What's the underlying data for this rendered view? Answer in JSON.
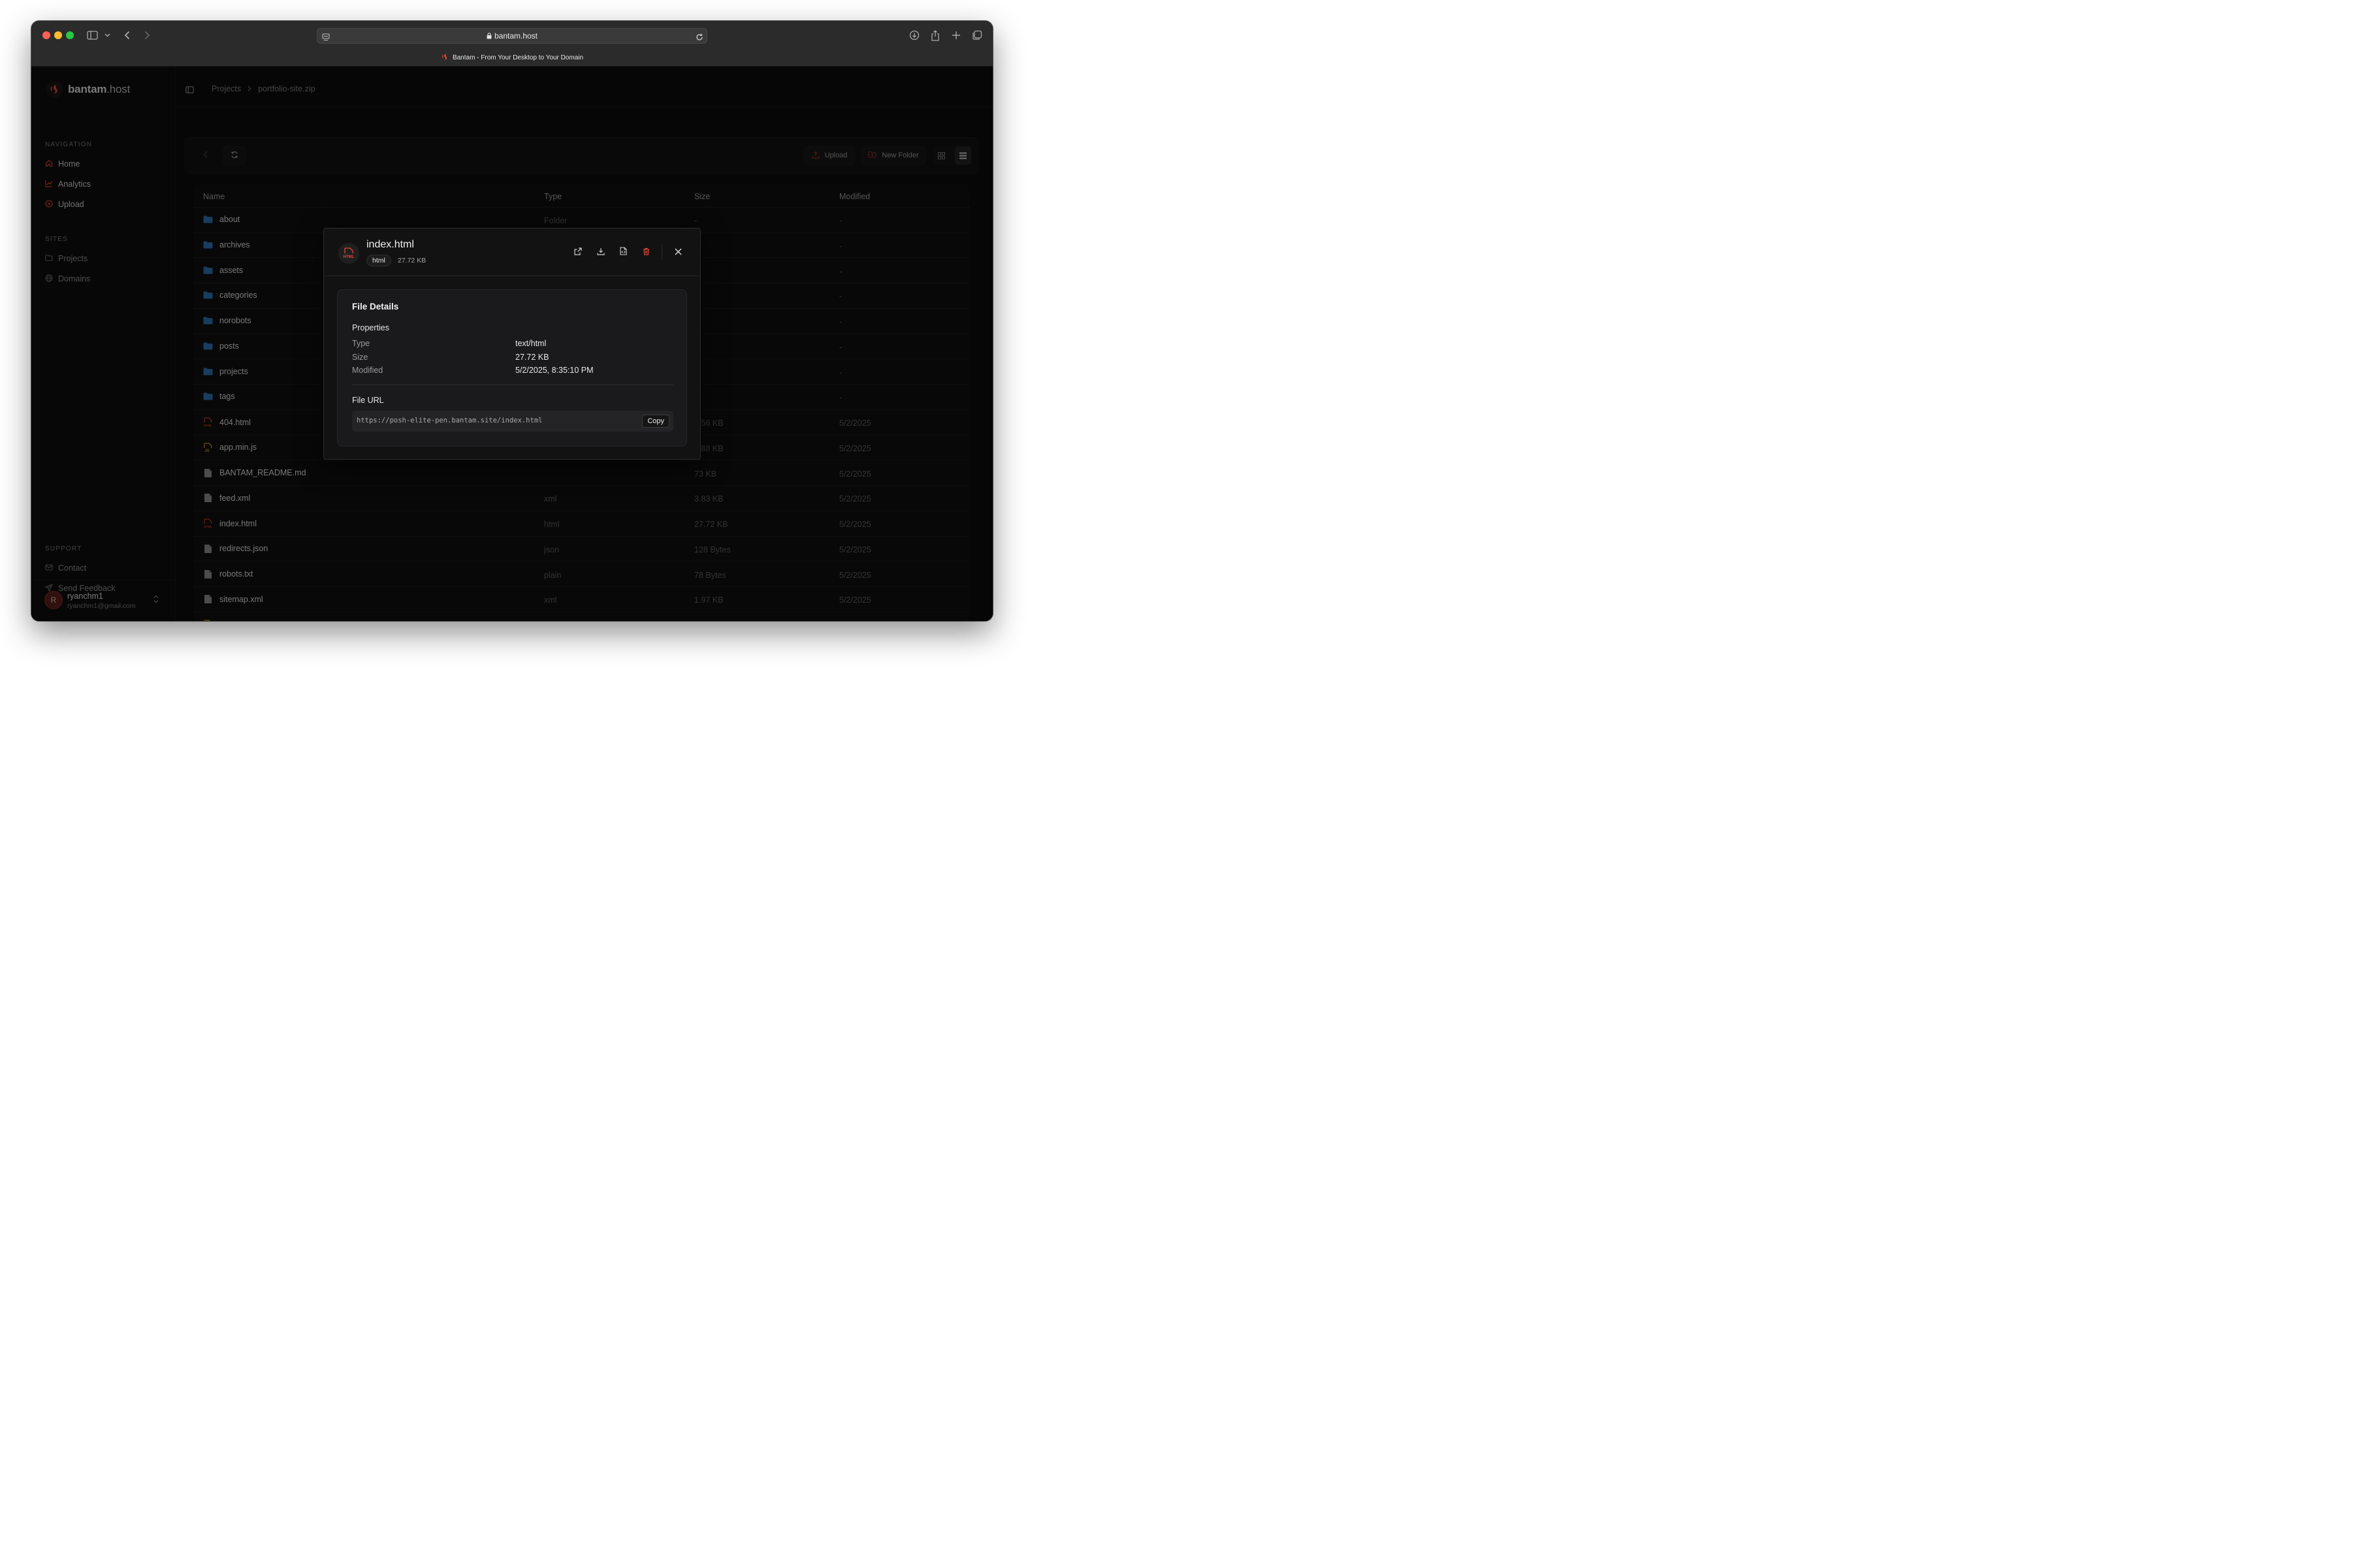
{
  "browser": {
    "url": "bantam.host",
    "tab_title": "Bantam - From Your Desktop to Your Domain"
  },
  "brand": {
    "name_bold": "bantam",
    "name_suffix": ".host"
  },
  "sidebar": {
    "navigation_label": "NAVIGATION",
    "navigation": [
      {
        "label": "Home",
        "icon": "home-icon"
      },
      {
        "label": "Analytics",
        "icon": "chart-icon"
      },
      {
        "label": "Upload",
        "icon": "upload-circle-icon"
      }
    ],
    "sites_label": "SITES",
    "sites": [
      {
        "label": "Projects",
        "icon": "folder-icon"
      },
      {
        "label": "Domains",
        "icon": "globe-icon"
      }
    ],
    "support_label": "SUPPORT",
    "support": [
      {
        "label": "Contact",
        "icon": "mail-icon"
      },
      {
        "label": "Send Feedback",
        "icon": "send-icon"
      }
    ],
    "user": {
      "initial": "R",
      "name": "ryanchm1",
      "email": "ryanchm1@gmail.com"
    }
  },
  "breadcrumb": {
    "root": "Projects",
    "current": "portfolio-site.zip"
  },
  "toolbar": {
    "upload_label": "Upload",
    "new_folder_label": "New Folder"
  },
  "table": {
    "headers": {
      "name": "Name",
      "type": "Type",
      "size": "Size",
      "modified": "Modified"
    },
    "rows": [
      {
        "name": "about",
        "kind": "folder",
        "type": "Folder",
        "size": "-",
        "modified": "-"
      },
      {
        "name": "archives",
        "kind": "folder",
        "type": "Folder",
        "size": "-",
        "modified": "-"
      },
      {
        "name": "assets",
        "kind": "folder",
        "type": "",
        "size": "",
        "modified": "-"
      },
      {
        "name": "categories",
        "kind": "folder",
        "type": "",
        "size": "",
        "modified": "-"
      },
      {
        "name": "norobots",
        "kind": "folder",
        "type": "",
        "size": "",
        "modified": "-"
      },
      {
        "name": "posts",
        "kind": "folder",
        "type": "",
        "size": "",
        "modified": "-"
      },
      {
        "name": "projects",
        "kind": "folder",
        "type": "",
        "size": "",
        "modified": "-"
      },
      {
        "name": "tags",
        "kind": "folder",
        "type": "",
        "size": "",
        "modified": "-"
      },
      {
        "name": "404.html",
        "kind": "html",
        "type": "",
        "size": "1.56 KB",
        "modified": "5/2/2025"
      },
      {
        "name": "app.min.js",
        "kind": "js",
        "type": "",
        "size": "3.88 KB",
        "modified": "5/2/2025"
      },
      {
        "name": "BANTAM_README.md",
        "kind": "doc",
        "type": "",
        "size": "73 KB",
        "modified": "5/2/2025"
      },
      {
        "name": "feed.xml",
        "kind": "doc",
        "type": "xml",
        "size": "3.83 KB",
        "modified": "5/2/2025"
      },
      {
        "name": "index.html",
        "kind": "html",
        "type": "html",
        "size": "27.72 KB",
        "modified": "5/2/2025"
      },
      {
        "name": "redirects.json",
        "kind": "doc",
        "type": "json",
        "size": "128 Bytes",
        "modified": "5/2/2025"
      },
      {
        "name": "robots.txt",
        "kind": "doc",
        "type": "plain",
        "size": "78 Bytes",
        "modified": "5/2/2025"
      },
      {
        "name": "sitemap.xml",
        "kind": "doc",
        "type": "xml",
        "size": "1.97 KB",
        "modified": "5/2/2025"
      },
      {
        "name": "sw.min.js",
        "kind": "js",
        "type": "javascript",
        "size": "1.09 KB",
        "modified": "5/2/2025"
      }
    ]
  },
  "modal": {
    "file_name": "index.html",
    "ext_badge": "html",
    "size": "27.72 KB",
    "details_title": "File Details",
    "properties_title": "Properties",
    "properties": [
      {
        "label": "Type",
        "value": "text/html"
      },
      {
        "label": "Size",
        "value": "27.72 KB"
      },
      {
        "label": "Modified",
        "value": "5/2/2025, 8:35:10 PM"
      }
    ],
    "url_title": "File URL",
    "url": "https://posh-elite-pen.bantam.site/index.html",
    "copy_label": "Copy"
  },
  "colors": {
    "accent": "#e5483a",
    "folder": "#2f6fb0",
    "html_icon": "#c0392b",
    "js_icon": "#b8912f",
    "doc_icon": "#8a8a8a",
    "delete": "#e5483a"
  }
}
